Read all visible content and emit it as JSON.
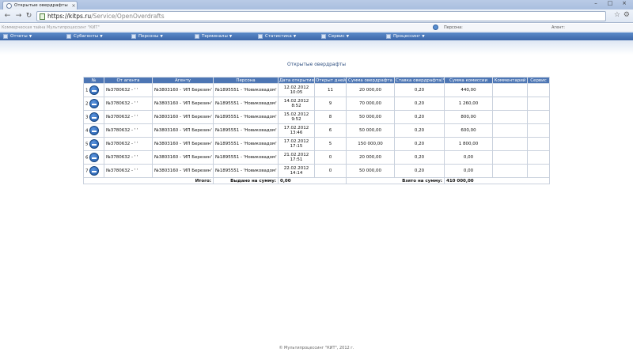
{
  "browser": {
    "tab_title": "Открытые овердрафты",
    "url_host": "https://kitps.ru",
    "url_path": "/Service/OpenOverdrafts"
  },
  "app": {
    "notice": "Коммерческая тайна Мультипроцессинг \"КИТ\"",
    "persona_label": "Персона:",
    "agent_label": "Агент:"
  },
  "menu": [
    {
      "label": "Отчеты",
      "icon": "reports-icon"
    },
    {
      "label": "Субагенты",
      "icon": "subagents-icon"
    },
    {
      "label": "Персоны",
      "icon": "persons-icon"
    },
    {
      "label": "Терминалы",
      "icon": "terminals-icon"
    },
    {
      "label": "Статистика",
      "icon": "statistics-icon"
    },
    {
      "label": "Сервис",
      "icon": "service-icon"
    },
    {
      "label": "Процессинг",
      "icon": "processing-icon"
    }
  ],
  "page_title": "Открытые овердрафты",
  "table": {
    "columns": [
      "№",
      "От агента",
      "Агенту",
      "Персона",
      "Дата открытия",
      "Открыт дней",
      "Сумма овердрафта",
      "Ставка овердрафта(%)",
      "Сумма комиссии",
      "Комментарий",
      "Сервис"
    ],
    "rows": [
      {
        "n": "1",
        "from_agent": "№3780632 - '   '",
        "to_agent": "№3803160 - 'ИП Березин'",
        "persona": "№1895551 - 'Новиковадом'",
        "date": "12.02.2012",
        "time": "10:05",
        "days": "11",
        "amount": "20 000,00",
        "rate": "0,20",
        "commission": "440,00",
        "comment": ""
      },
      {
        "n": "2",
        "from_agent": "№3780632 - '   '",
        "to_agent": "№3803160 - 'ИП Березин'",
        "persona": "№1895551 - 'Новиковадом'",
        "date": "14.02.2012",
        "time": "8:52",
        "days": "9",
        "amount": "70 000,00",
        "rate": "0,20",
        "commission": "1 260,00",
        "comment": ""
      },
      {
        "n": "3",
        "from_agent": "№3780632 - '   '",
        "to_agent": "№3803160 - 'ИП Березин'",
        "persona": "№1895551 - 'Новиковадом'",
        "date": "15.02.2012",
        "time": "9:52",
        "days": "8",
        "amount": "50 000,00",
        "rate": "0,20",
        "commission": "800,00",
        "comment": ""
      },
      {
        "n": "4",
        "from_agent": "№3780632 - '   '",
        "to_agent": "№3803160 - 'ИП Березин'",
        "persona": "№1895551 - 'Новиковадом'",
        "date": "17.02.2012",
        "time": "13:46",
        "days": "6",
        "amount": "50 000,00",
        "rate": "0,20",
        "commission": "600,00",
        "comment": ""
      },
      {
        "n": "5",
        "from_agent": "№3780632 - '   '",
        "to_agent": "№3803160 - 'ИП Березин'",
        "persona": "№1895551 - 'Новиковадом'",
        "date": "17.02.2012",
        "time": "17:15",
        "days": "5",
        "amount": "150 000,00",
        "rate": "0,20",
        "commission": "1 800,00",
        "comment": ""
      },
      {
        "n": "6",
        "from_agent": "№3780632 - '   '",
        "to_agent": "№3803160 - 'ИП Березин'",
        "persona": "№1895551 - 'Новиковадом'",
        "date": "21.02.2012",
        "time": "17:51",
        "days": "0",
        "amount": "20 000,00",
        "rate": "0,20",
        "commission": "0,00",
        "comment": ""
      },
      {
        "n": "7",
        "from_agent": "№3780632 - '   '",
        "to_agent": "№3803160 - 'ИП Березин'",
        "persona": "№1895551 - 'Новиковадом'",
        "date": "22.02.2012",
        "time": "14:14",
        "days": "0",
        "amount": "50 000,00",
        "rate": "0,20",
        "commission": "0,00",
        "comment": ""
      }
    ],
    "totals": {
      "label": "Итого:",
      "issued_label": "Выдано на сумму:",
      "issued_value": "0,00",
      "taken_label": "Взято на сумму:",
      "taken_value": "410 000,00"
    }
  },
  "footer": "© Мультипроцессинг \"КИТ\", 2012 г."
}
